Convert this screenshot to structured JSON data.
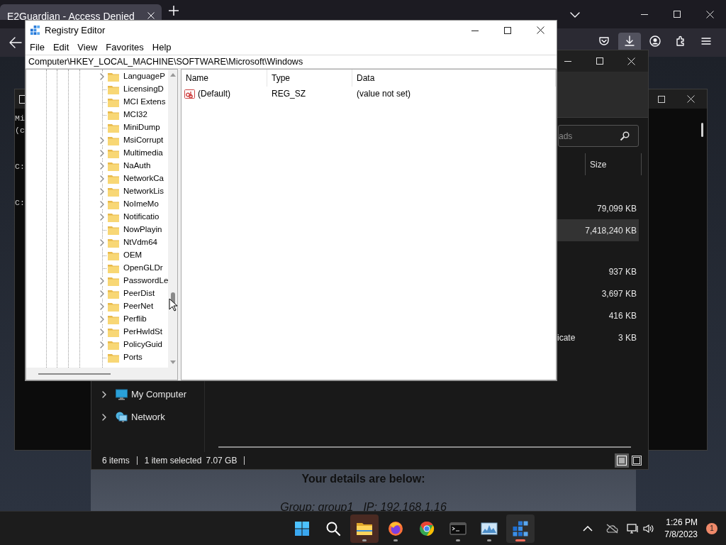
{
  "browser": {
    "tab": {
      "title": "E2Guardian - Access Denied",
      "selected": true
    },
    "toolbar_buttons": [
      {
        "kind": "pocket",
        "selected": false
      },
      {
        "kind": "download",
        "selected": true
      },
      {
        "kind": "account",
        "selected": false
      },
      {
        "kind": "extensions",
        "selected": false
      },
      {
        "kind": "menu",
        "selected": false
      }
    ],
    "page": {
      "heading": "Your details are below:",
      "group": "Group: group1",
      "ip": "IP: 192.168.1.16"
    }
  },
  "console": {
    "blocks": [
      [
        "Mi",
        "(c"
      ],
      [
        "C:"
      ],
      [
        "C:"
      ]
    ]
  },
  "explorer": {
    "search": {
      "placeholder": "ads"
    },
    "columns": [
      "Size"
    ],
    "groups": [
      {
        "rows": [
          {
            "size": "79,099 KB",
            "selected": false
          },
          {
            "size": "7,418,240 KB",
            "selected": true
          }
        ]
      },
      {
        "rows": [
          {
            "size": "937 KB",
            "selected": false
          },
          {
            "size": "3,697 KB",
            "selected": false
          },
          {
            "size": "416 KB",
            "selected": false
          },
          {
            "type": "icate",
            "size": "3 KB",
            "selected": false
          }
        ]
      }
    ],
    "nav_items": [
      {
        "label": "My Computer",
        "kind": "computer",
        "expandable": true
      },
      {
        "label": "Network",
        "kind": "network",
        "expandable": true
      }
    ],
    "status": {
      "item_count": "6 items",
      "selection": "1 item selected",
      "selection_size": "7.07 GB"
    },
    "views": [
      {
        "kind": "details",
        "selected": true
      },
      {
        "kind": "tiles",
        "selected": false
      }
    ]
  },
  "registry": {
    "title": "Registry Editor",
    "menu": [
      "File",
      "Edit",
      "View",
      "Favorites",
      "Help"
    ],
    "address": "Computer\\HKEY_LOCAL_MACHINE\\SOFTWARE\\Microsoft\\Windows",
    "tree": [
      {
        "label": "LanguageP",
        "expandable": true
      },
      {
        "label": "LicensingD",
        "expandable": false
      },
      {
        "label": "MCI Extens",
        "expandable": false
      },
      {
        "label": "MCI32",
        "expandable": false
      },
      {
        "label": "MiniDump",
        "expandable": false
      },
      {
        "label": "MsiCorrupt",
        "expandable": true
      },
      {
        "label": "Multimedia",
        "expandable": true
      },
      {
        "label": "NaAuth",
        "expandable": true
      },
      {
        "label": "NetworkCa",
        "expandable": true
      },
      {
        "label": "NetworkLis",
        "expandable": true
      },
      {
        "label": "NoImeMo",
        "expandable": true
      },
      {
        "label": "Notificatio",
        "expandable": true
      },
      {
        "label": "NowPlayin",
        "expandable": false
      },
      {
        "label": "NtVdm64",
        "expandable": true
      },
      {
        "label": "OEM",
        "expandable": false
      },
      {
        "label": "OpenGLDr",
        "expandable": false
      },
      {
        "label": "PasswordLe",
        "expandable": true
      },
      {
        "label": "PeerDist",
        "expandable": true
      },
      {
        "label": "PeerNet",
        "expandable": true
      },
      {
        "label": "Perflib",
        "expandable": true
      },
      {
        "label": "PerHwIdSt",
        "expandable": true
      },
      {
        "label": "PolicyGuid",
        "expandable": true
      },
      {
        "label": "Ports",
        "expandable": false
      }
    ],
    "columns": [
      "Name",
      "Type",
      "Data"
    ],
    "values": [
      {
        "name": "(Default)",
        "type": "REG_SZ",
        "data": "(value not set)"
      }
    ]
  },
  "taskbar": {
    "apps": [
      {
        "kind": "start",
        "running": false,
        "active": false,
        "highlighted": false
      },
      {
        "kind": "search",
        "running": false,
        "active": false,
        "highlighted": false
      },
      {
        "kind": "explorer",
        "running": true,
        "active": false,
        "highlighted": true
      },
      {
        "kind": "firefox",
        "running": true,
        "active": false,
        "highlighted": false
      },
      {
        "kind": "chrome",
        "running": false,
        "active": false,
        "highlighted": false
      },
      {
        "kind": "terminal",
        "running": true,
        "active": false,
        "highlighted": false
      },
      {
        "kind": "monitor",
        "running": true,
        "active": false,
        "highlighted": false
      },
      {
        "kind": "registry",
        "running": true,
        "active": true,
        "highlighted": true
      }
    ],
    "tray": {
      "time": "1:26 PM",
      "date": "7/8/2023",
      "notifications": "1"
    }
  }
}
